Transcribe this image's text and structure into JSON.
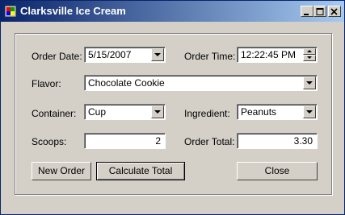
{
  "window": {
    "title": "Clarksville Ice Cream"
  },
  "labels": {
    "order_date": "Order Date:",
    "order_time": "Order Time:",
    "flavor": "Flavor:",
    "container": "Container:",
    "ingredient": "Ingredient:",
    "scoops": "Scoops:",
    "order_total": "Order Total:"
  },
  "fields": {
    "order_date": "5/15/2007",
    "order_time": "12:22:45 PM",
    "flavor": "Chocolate Cookie",
    "container": "Cup",
    "ingredient": "Peanuts",
    "scoops": "2",
    "order_total": "3.30"
  },
  "buttons": {
    "new_order": "New Order",
    "calculate_total": "Calculate Total",
    "close": "Close"
  },
  "colors": {
    "title_start": "#0a246a",
    "title_end": "#a6caf0",
    "face": "#d4d0c8"
  },
  "icons": [
    "app-icon",
    "minimize-icon",
    "maximize-icon",
    "close-icon",
    "chevron-down-icon",
    "spin-up-icon",
    "spin-down-icon"
  ]
}
